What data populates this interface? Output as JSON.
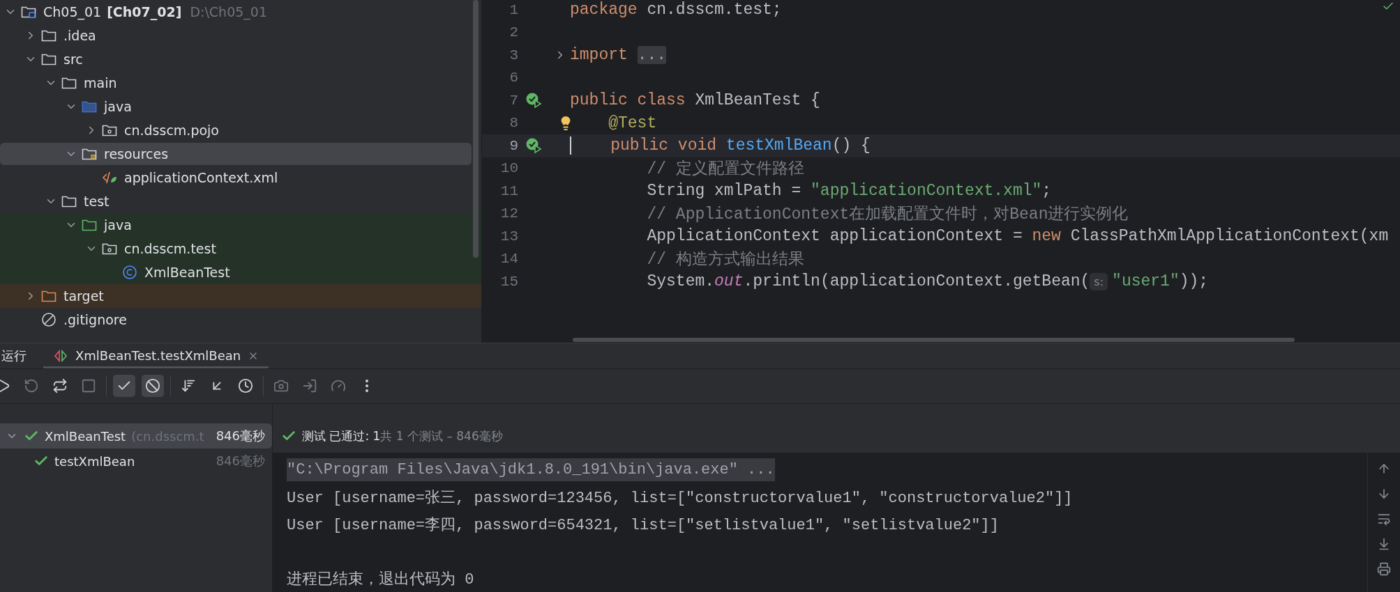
{
  "project_tree": {
    "items": [
      {
        "label": "Ch05_01",
        "suffix": "[Ch07_02]",
        "path": "D:\\Ch05_01",
        "kind": "module",
        "expanded": true,
        "selected": false,
        "children": [
          {
            "label": ".idea",
            "kind": "folder",
            "expanded": false,
            "selected": false
          },
          {
            "label": "src",
            "kind": "folder",
            "expanded": true,
            "selected": false,
            "children": [
              {
                "label": "main",
                "kind": "folder",
                "expanded": true,
                "selected": false,
                "children": [
                  {
                    "label": "java",
                    "kind": "source",
                    "expanded": true,
                    "selected": false,
                    "children": [
                      {
                        "label": "cn.dsscm.pojo",
                        "kind": "package",
                        "expanded": false,
                        "selected": false
                      }
                    ]
                  },
                  {
                    "label": "resources",
                    "kind": "resources",
                    "expanded": true,
                    "selected": true,
                    "children": [
                      {
                        "label": "applicationContext.xml",
                        "kind": "xml",
                        "selected": false
                      }
                    ]
                  }
                ]
              },
              {
                "label": "test",
                "kind": "folder",
                "expanded": true,
                "selected": false,
                "children": [
                  {
                    "label": "java",
                    "kind": "tests",
                    "color": "#253228",
                    "expanded": true,
                    "selected": false,
                    "children": [
                      {
                        "label": "cn.dsscm.test",
                        "kind": "package",
                        "color": "#253228",
                        "expanded": true,
                        "selected": false,
                        "children": [
                          {
                            "label": "XmlBeanTest",
                            "kind": "class",
                            "color": "#253228",
                            "selected": false
                          }
                        ]
                      }
                    ]
                  }
                ]
              }
            ]
          },
          {
            "label": "target",
            "kind": "excluded",
            "color": "#3d3125",
            "expanded": false,
            "selected": false
          },
          {
            "label": ".gitignore",
            "kind": "ignored",
            "selected": false
          }
        ]
      }
    ]
  },
  "editor": {
    "lines": [
      {
        "number": "1",
        "kind": "code",
        "current": false,
        "tokens": [
          {
            "text": "package ",
            "kind": "keyword"
          },
          {
            "text": "cn.dsscm.test;",
            "kind": "plain"
          }
        ]
      },
      {
        "number": "2",
        "kind": "code",
        "current": false
      },
      {
        "number": "3",
        "kind": "folded",
        "current": false,
        "tokens": [
          {
            "text": "import ",
            "kind": "keyword"
          },
          {
            "text": "...",
            "kind": "folded"
          }
        ]
      },
      {
        "number": "6",
        "kind": "code",
        "current": false
      },
      {
        "number": "7",
        "kind": "test",
        "current": false,
        "tokens": [
          {
            "text": "public class ",
            "kind": "keyword"
          },
          {
            "text": "XmlBeanTest {",
            "kind": "plain"
          }
        ]
      },
      {
        "number": "8",
        "kind": "intention",
        "current": false,
        "tokens": [
          {
            "text": "    @Test",
            "kind": "annotation"
          }
        ]
      },
      {
        "number": "9",
        "kind": "test",
        "current": true,
        "tokens": [
          {
            "text": "    public void ",
            "kind": "keyword"
          },
          {
            "text": "testXmlBean",
            "kind": "method"
          },
          {
            "text": "() {",
            "kind": "plain"
          }
        ]
      },
      {
        "number": "10",
        "kind": "code",
        "current": false,
        "tokens": [
          {
            "text": "        // 定义配置文件路径",
            "kind": "comment"
          }
        ]
      },
      {
        "number": "11",
        "kind": "code",
        "current": false,
        "tokens": [
          {
            "text": "        String xmlPath = ",
            "kind": "plain"
          },
          {
            "text": "\"applicationContext.xml\"",
            "kind": "string"
          },
          {
            "text": ";",
            "kind": "plain"
          }
        ]
      },
      {
        "number": "12",
        "kind": "code",
        "current": false,
        "tokens": [
          {
            "text": "        // ApplicationContext在加载配置文件时，对Bean进行实例化",
            "kind": "comment"
          }
        ]
      },
      {
        "number": "13",
        "kind": "code",
        "current": false,
        "tokens": [
          {
            "text": "        ApplicationContext applicationContext = ",
            "kind": "plain"
          },
          {
            "text": "new",
            "kind": "keyword"
          },
          {
            "text": " ClassPathXmlApplicationContext(xm",
            "kind": "plain"
          }
        ]
      },
      {
        "number": "14",
        "kind": "code",
        "current": false,
        "tokens": [
          {
            "text": "        // 构造方式输出结果",
            "kind": "comment"
          }
        ]
      },
      {
        "number": "15",
        "kind": "code",
        "current": false,
        "tokens": [
          {
            "text": "        System.",
            "kind": "plain"
          },
          {
            "text": "out",
            "kind": "field"
          },
          {
            "text": ".println(applicationContext.getBean(",
            "kind": "plain"
          },
          {
            "text": "s:",
            "kind": "hint"
          },
          {
            "text": "\"user1\"",
            "kind": "string"
          },
          {
            "text": "));",
            "kind": "plain"
          }
        ]
      }
    ]
  },
  "run_panel": {
    "title": "运行",
    "tabs": [
      {
        "label": "XmlBeanTest.testXmlBean",
        "selected": true
      }
    ],
    "toolbar": [
      {
        "kind": "rerun",
        "on": false,
        "disabled": false
      },
      {
        "kind": "rerun_failed",
        "on": false,
        "disabled": true
      },
      {
        "kind": "toggle_auto",
        "on": false,
        "disabled": false
      },
      {
        "kind": "stop",
        "on": false,
        "disabled": true
      },
      {
        "kind": "separator"
      },
      {
        "kind": "show_passed",
        "on": true,
        "disabled": false
      },
      {
        "kind": "show_ignored",
        "on": true,
        "disabled": false
      },
      {
        "kind": "separator"
      },
      {
        "kind": "sort",
        "on": false,
        "disabled": false
      },
      {
        "kind": "collapse",
        "on": false,
        "disabled": false
      },
      {
        "kind": "history",
        "on": false,
        "disabled": false
      },
      {
        "kind": "separator"
      },
      {
        "kind": "camera",
        "on": false,
        "disabled": true
      },
      {
        "kind": "export",
        "on": false,
        "disabled": true
      },
      {
        "kind": "gauge",
        "on": false,
        "disabled": true
      },
      {
        "kind": "more",
        "on": false,
        "disabled": false
      }
    ],
    "tests": [
      {
        "name": "XmlBeanTest",
        "package": "(cn.dsscm.t",
        "time": "846毫秒",
        "passed": true,
        "expanded": true,
        "selected": true,
        "children": [
          {
            "name": "testXmlBean",
            "time": "846毫秒",
            "passed": true,
            "selected": false
          }
        ]
      }
    ],
    "status": {
      "passed": true,
      "text": "测试 已通过: 1",
      "detail": "共 1 个测试 – 846毫秒"
    },
    "console": [
      {
        "kind": "command",
        "text": "\"C:\\Program Files\\Java\\jdk1.8.0_191\\bin\\java.exe\" ..."
      },
      {
        "kind": "output",
        "text": "User [username=张三, password=123456, list=[\"constructorvalue1\", \"constructorvalue2\"]]"
      },
      {
        "kind": "output",
        "text": "User [username=李四, password=654321, list=[\"setlistvalue1\", \"setlistvalue2\"]]"
      },
      {
        "kind": "exit",
        "text": "进程已结束，退出代码为 0"
      }
    ]
  }
}
